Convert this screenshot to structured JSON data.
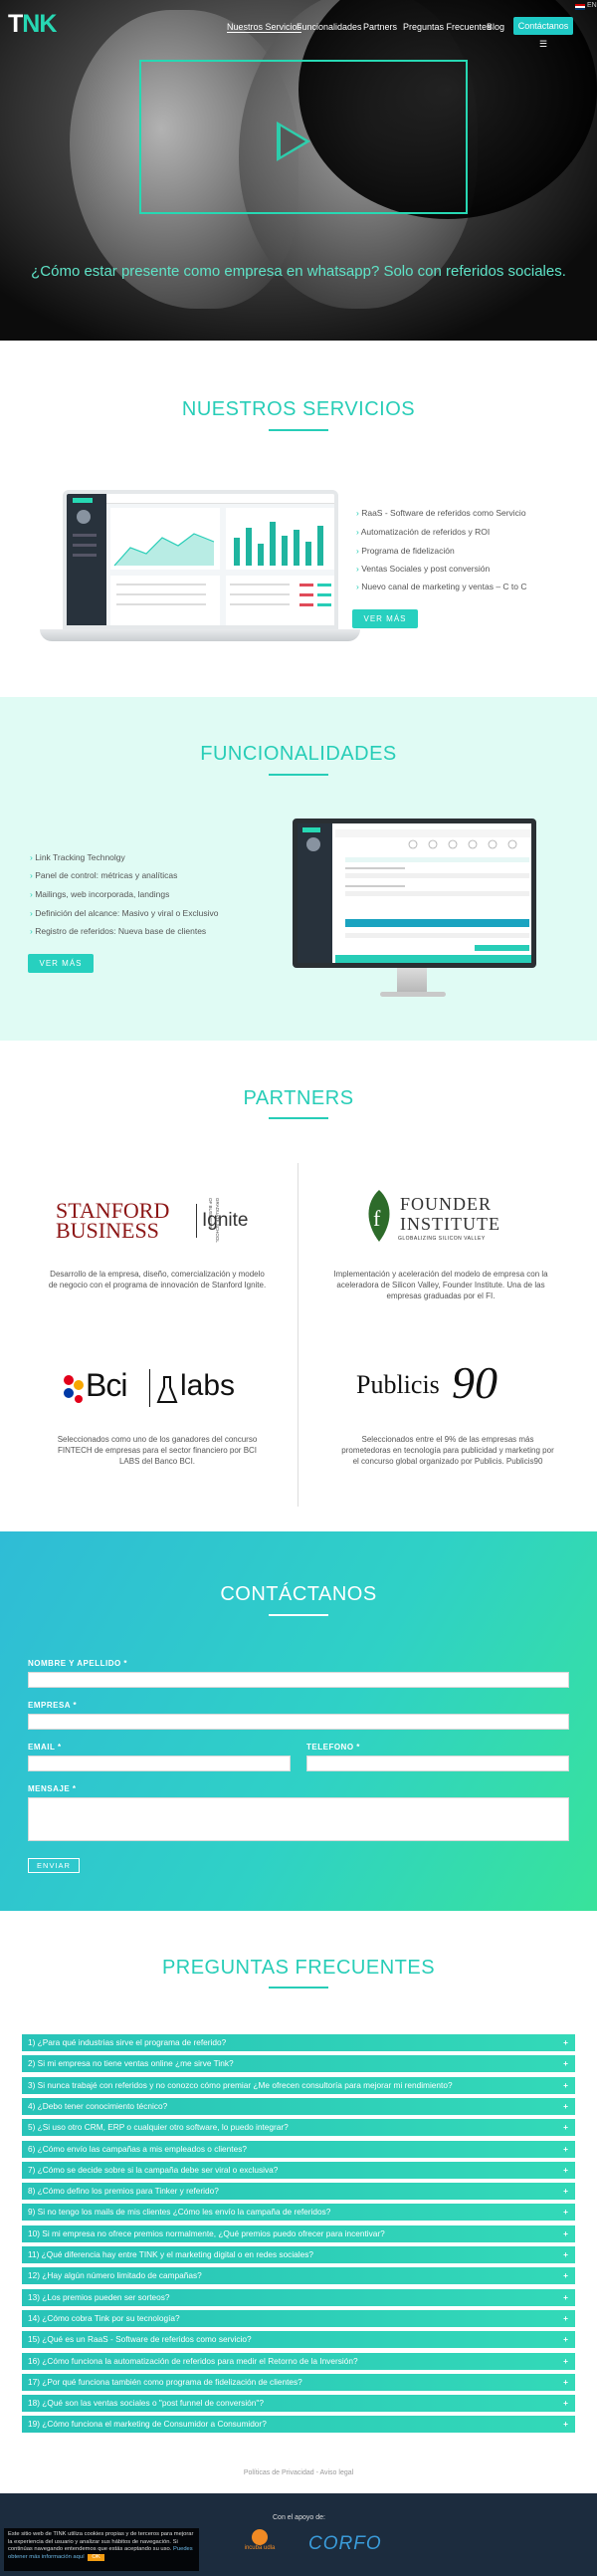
{
  "header": {
    "logo_t": "T",
    "logo_rest": "NK",
    "nav": [
      "Nuestros Servicios",
      "Funcionalidades",
      "Partners",
      "Preguntas Frecuentes",
      "Blog"
    ],
    "contact_button": "Contáctanos ☰",
    "language": "EN"
  },
  "hero": {
    "title": "¿Cómo estar presente como empresa en whatsapp? Solo con referidos sociales."
  },
  "services": {
    "title": "NUESTROS SERVICIOS",
    "items": [
      "RaaS - Software de referidos como Servicio",
      "Automatización de referidos y ROI",
      "Programa de fidelización",
      "Ventas Sociales y post conversión",
      "Nuevo canal de marketing y ventas – C to C"
    ],
    "button": "VER MÁS"
  },
  "features": {
    "title": "FUNCIONALIDADES",
    "items": [
      "Link Tracking Technolgy",
      "Panel de control: métricas y analíticas",
      "Mailings, web incorporada, landings",
      "Definición del alcance: Masivo y viral o Exclusivo",
      "Registro de referidos: Nueva base de clientes"
    ],
    "button": "VER MÁS"
  },
  "partners": {
    "title": "PARTNERS",
    "items": [
      {
        "logo_a": "STANFORD",
        "logo_b": "BUSINESS",
        "logo_c": "GRADUATE SCHOOL OF BUSINESS",
        "logo_d": "Ignite",
        "text": "Desarrollo de la empresa, diseño, comercialización y modelo de negocio con el programa de innovación de Stanford Ignite."
      },
      {
        "logo_a": "FOUNDER",
        "logo_b": "INSTITUTE",
        "logo_c": "GLOBALIZING SILICON VALLEY",
        "text": "Implementación y aceleración del modelo de empresa con la aceleradora de Silicon Valley, Founder Institute. Una de las empresas graduadas por el FI."
      },
      {
        "logo_a": "Bci",
        "logo_b": "labs",
        "text": "Seleccionados como uno de los ganadores del concurso FINTECH de empresas para el sector financiero por BCI LABS del Banco BCI."
      },
      {
        "logo_a": "Publicis",
        "logo_b": "90",
        "text": "Seleccionados entre el 9% de las empresas más prometedoras en tecnología para publicidad y marketing por el concurso global organizado por Publicis. Publicis90"
      }
    ]
  },
  "contact": {
    "title": "CONTÁCTANOS",
    "name_label": "NOMBRE Y APELLIDO *",
    "company_label": "EMPRESA *",
    "email_label": "EMAIL *",
    "phone_label": "TELEFONO *",
    "message_label": "MENSAJE *",
    "submit": "ENVIAR"
  },
  "faq": {
    "title": "PREGUNTAS FRECUENTES",
    "expand_symbol": "+",
    "items": [
      "1) ¿Para qué industrias sirve el programa de referido?",
      "2) Si mi empresa no tiene ventas online ¿me sirve Tink?",
      "3) Si nunca trabajé con referidos y no conozco cómo premiar ¿Me ofrecen consultoría para mejorar mi rendimiento?",
      "4) ¿Debo tener conocimiento técnico?",
      "5) ¿Si uso otro CRM, ERP o cualquier otro software, lo puedo integrar?",
      "6) ¿Cómo envío las campañas a mis empleados o clientes?",
      "7) ¿Cómo se decide sobre si la campaña debe ser viral o exclusiva?",
      "8) ¿Cómo defino los premios para Tinker y referido?",
      "9) Si no tengo los mails de mis clientes ¿Cómo les envío la campaña de referidos?",
      "10) Si mi empresa no ofrece premios normalmente, ¿Qué premios puedo ofrecer para incentivar?",
      "11) ¿Qué diferencia hay entre TINK y el marketing digital o en redes sociales?",
      "12) ¿Hay algún número limitado de campañas?",
      "13) ¿Los premios pueden ser sorteos?",
      "14) ¿Cómo cobra Tink por su tecnología?",
      "15) ¿Qué es un RaaS - Software de referidos como servicio?",
      "16) ¿Cómo funciona la automatización de referidos para medir el Retorno de la Inversión?",
      "17) ¿Por qué funciona también como programa de fidelización de clientes?",
      "18) ¿Qué son las ventas sociales o \"post funnel de conversión\"?",
      "19) ¿Cómo funciona el marketing de Consumidor a Consumidor?"
    ]
  },
  "footer": {
    "links": "Políticas de Privacidad - Aviso legal",
    "support_label": "Con el apoyo de:",
    "sponsor_1": "incuba udla",
    "sponsor_2": "CORFO",
    "cookie_text": "Este sitio web de TINK utiliza cookies propias y de terceros para mejorar la experiencia del usuario y analizar sus hábitos de navegación. Si continúas navegando entendemos que estás aceptando su uso.",
    "cookie_more": "Puedes obtener más información aquí",
    "cookie_ok": "OK"
  },
  "colors": {
    "accent": "#27cdb7",
    "footer": "#1c2c3e"
  }
}
